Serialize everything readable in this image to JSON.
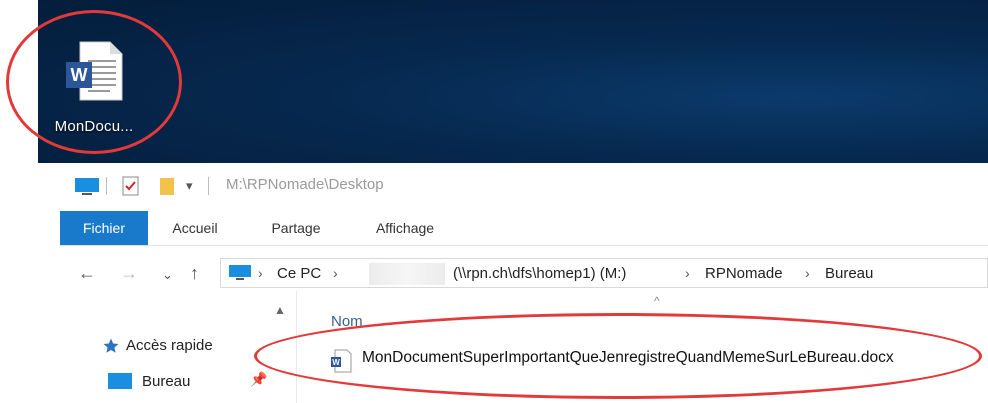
{
  "desktop": {
    "icon_label": "MonDocu..."
  },
  "titlebar": {
    "path": "M:\\RPNomade\\Desktop"
  },
  "ribbon": {
    "tabs": [
      {
        "label": "Fichier",
        "active": true
      },
      {
        "label": "Accueil",
        "active": false
      },
      {
        "label": "Partage",
        "active": false
      },
      {
        "label": "Affichage",
        "active": false
      }
    ]
  },
  "address": {
    "crumbs": [
      "Ce PC",
      "(\\\\rpn.ch\\dfs\\homep1) (M:)",
      "RPNomade",
      "Bureau"
    ]
  },
  "navpane": {
    "items": [
      "Accès rapide",
      "Bureau"
    ]
  },
  "content": {
    "column_header": "Nom",
    "files": [
      {
        "name": "MonDocumentSuperImportantQueJenregistreQuandMemeSurLeBureau.docx"
      }
    ]
  },
  "colors": {
    "accent": "#1979ca",
    "annotation": "#e23a3a",
    "desktop": "#06284e"
  }
}
